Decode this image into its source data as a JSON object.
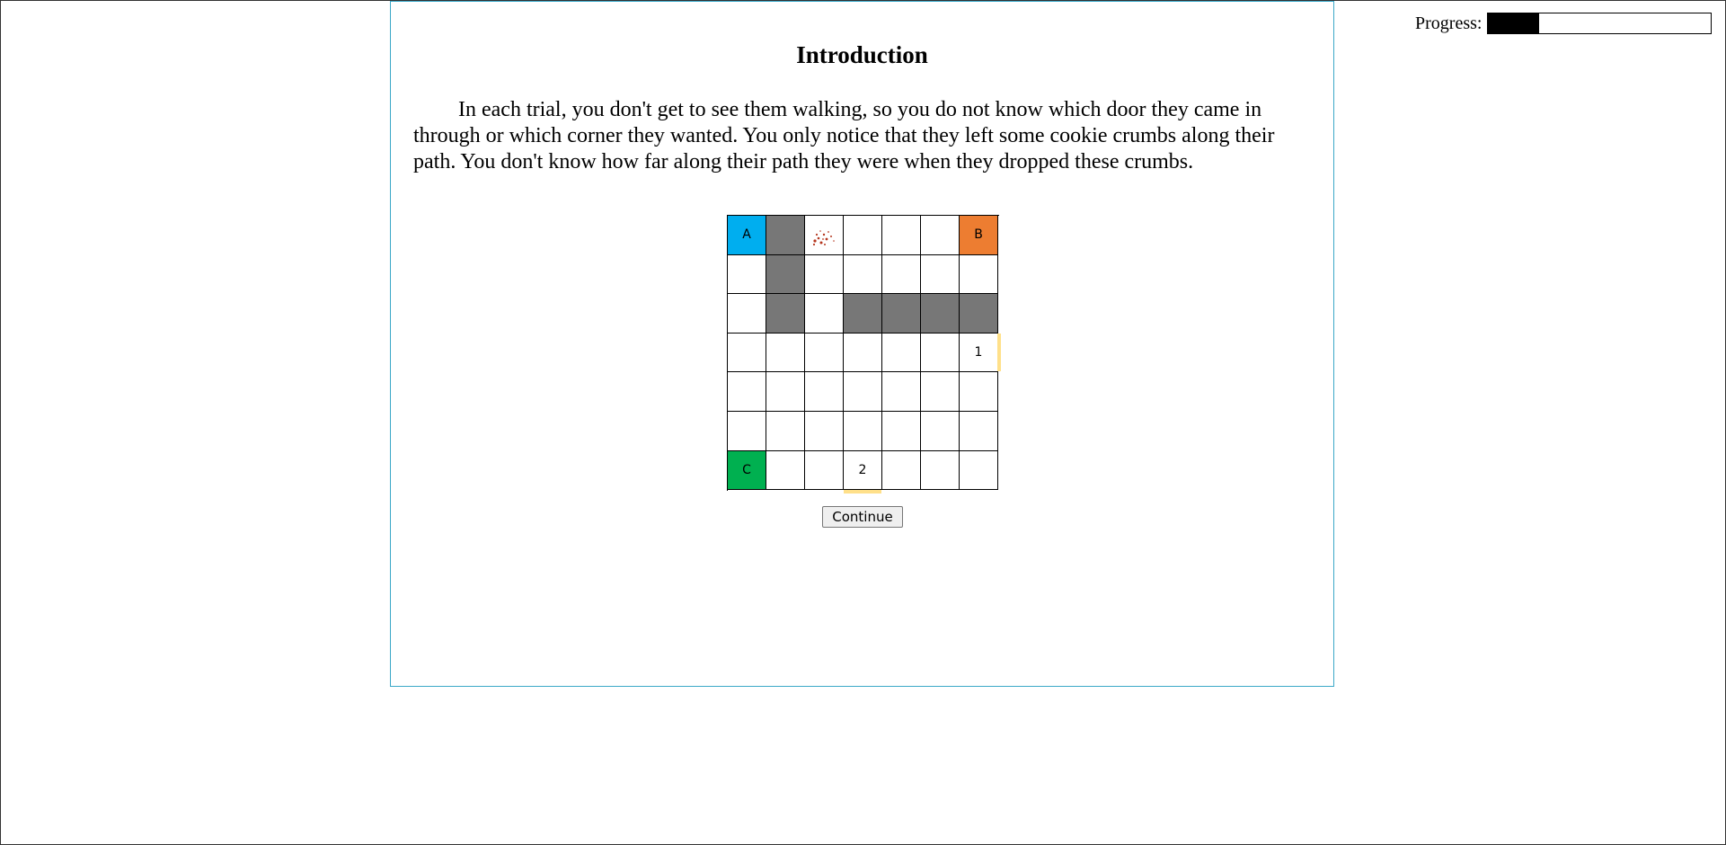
{
  "progress": {
    "label": "Progress:",
    "fraction": 0.23
  },
  "intro": {
    "title": "Introduction",
    "body": "In each trial, you don't get to see them walking, so you do not know which door they came in through or which corner they wanted. You only notice that they left some cookie crumbs along their path. You don't know how far along their path they were when they dropped these crumbs."
  },
  "grid": {
    "rows": 7,
    "cols": 7,
    "cells": [
      [
        "A",
        "wall",
        "crumbs",
        "",
        "",
        "",
        "B"
      ],
      [
        "",
        "wall",
        "",
        "",
        "",
        "",
        ""
      ],
      [
        "",
        "wall",
        "",
        "wall",
        "wall",
        "wall",
        "wall"
      ],
      [
        "",
        "",
        "",
        "",
        "",
        "",
        "1"
      ],
      [
        "",
        "",
        "",
        "",
        "",
        "",
        ""
      ],
      [
        "",
        "",
        "",
        "",
        "",
        "",
        ""
      ],
      [
        "C",
        "",
        "",
        "2",
        "",
        "",
        ""
      ]
    ],
    "corner_colors": {
      "A": "#00aeef",
      "B": "#ed7d31",
      "C": "#00b050"
    },
    "wall_color": "#777777",
    "door_color": "#ffe08a",
    "doors": [
      {
        "label": "1",
        "side": "right"
      },
      {
        "label": "2",
        "side": "bottom"
      }
    ]
  },
  "buttons": {
    "continue_label": "Continue"
  }
}
